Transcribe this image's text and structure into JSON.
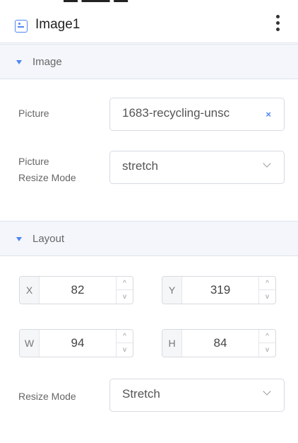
{
  "header": {
    "title": "Image1"
  },
  "sections": {
    "image": {
      "label": "Image"
    },
    "layout": {
      "label": "Layout"
    }
  },
  "image": {
    "picture_label": "Picture",
    "picture_value": "1683-recycling-unsc",
    "picture_clear": "×",
    "resize_label_line1": "Picture",
    "resize_label_line2": "Resize Mode",
    "resize_value": "stretch"
  },
  "layout": {
    "x_label": "X",
    "x_value": "82",
    "y_label": "Y",
    "y_value": "319",
    "w_label": "W",
    "w_value": "94",
    "h_label": "H",
    "h_value": "84",
    "resize_mode_label": "Resize Mode",
    "resize_mode_value": "Stretch"
  },
  "icons": {
    "component": "image-component-icon",
    "menu": "more-vertical-icon",
    "collapse": "triangle-down-icon",
    "dropdown": "chevron-down-icon",
    "clear": "close-icon",
    "spin_up": "chevron-up-icon",
    "spin_down": "chevron-down-icon"
  },
  "colors": {
    "accent": "#4f86f2",
    "section_bg": "#f4f6fb",
    "border": "#d6dae0"
  }
}
